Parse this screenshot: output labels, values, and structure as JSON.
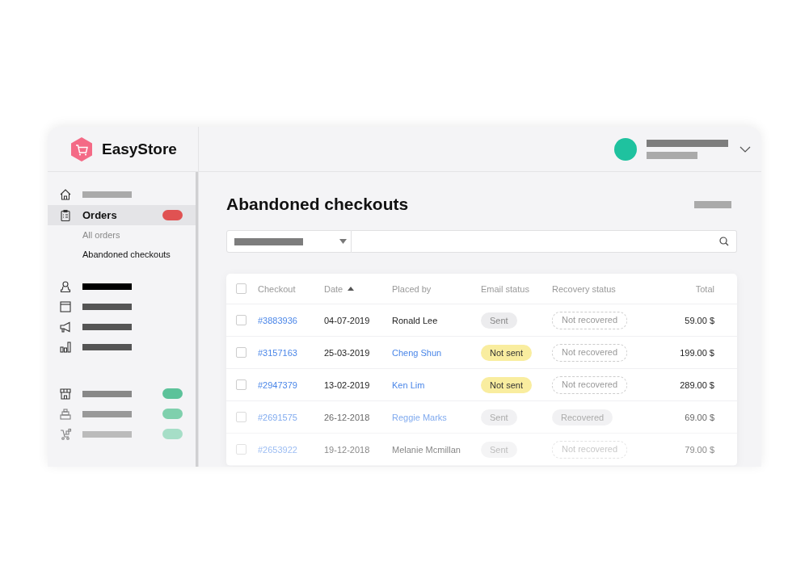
{
  "brand": {
    "name": "EasyStore"
  },
  "sidebar": {
    "groups": [
      [
        {
          "kind": "home",
          "selected": false
        }
      ],
      [
        {
          "kind": "orders",
          "label": "Orders",
          "selected": true,
          "color": "#e05252",
          "children": [
            {
              "label": "All orders",
              "selected": false
            },
            {
              "label": "Abandoned checkouts",
              "selected": true
            }
          ]
        }
      ],
      [
        {
          "kind": "person",
          "selected": false
        },
        {
          "kind": "box",
          "selected": false
        },
        {
          "kind": "megaphone",
          "selected": false
        },
        {
          "kind": "chart",
          "selected": false
        }
      ],
      [
        {
          "kind": "store",
          "selected": false,
          "color": "#5cc29a"
        },
        {
          "kind": "register",
          "selected": false,
          "color": "#7fd0ad"
        },
        {
          "kind": "delivery",
          "selected": false,
          "color": "#a6dec7"
        }
      ]
    ]
  },
  "page": {
    "title": "Abandoned checkouts"
  },
  "table": {
    "all_checked": false,
    "columns": [
      {
        "label": "Checkout",
        "sorted": false
      },
      {
        "label": "Date",
        "sorted": true
      },
      {
        "label": "Placed by",
        "sorted": false
      },
      {
        "label": "Email status",
        "sorted": false
      },
      {
        "label": "Recovery status",
        "sorted": false
      },
      {
        "label": "Total",
        "sorted": false
      }
    ],
    "rows": [
      {
        "checked": false,
        "checkout": "#3883936",
        "date": "04-07-2019",
        "placed_by": "Ronald Lee",
        "linked": false,
        "email": {
          "kind": "sent",
          "label": "Sent"
        },
        "recovery": {
          "kind": "not_recovered",
          "label": "Not recovered"
        },
        "total": "59.00 $"
      },
      {
        "checked": false,
        "checkout": "#3157163",
        "date": "25-03-2019",
        "placed_by": "Cheng Shun",
        "linked": true,
        "email": {
          "kind": "not_sent",
          "label": "Not sent"
        },
        "recovery": {
          "kind": "not_recovered",
          "label": "Not recovered"
        },
        "total": "199.00 $"
      },
      {
        "checked": false,
        "checkout": "#2947379",
        "date": "13-02-2019",
        "placed_by": "Ken Lim",
        "linked": true,
        "email": {
          "kind": "not_sent",
          "label": "Not sent"
        },
        "recovery": {
          "kind": "not_recovered",
          "label": "Not recovered"
        },
        "total": "289.00 $"
      },
      {
        "checked": false,
        "checkout": "#2691575",
        "date": "26-12-2018",
        "placed_by": "Reggie Marks",
        "linked": true,
        "email": {
          "kind": "sent",
          "label": "Sent"
        },
        "recovery": {
          "kind": "recovered",
          "label": "Recovered"
        },
        "total": "69.00 $"
      },
      {
        "checked": false,
        "checkout": "#2653922",
        "date": "19-12-2018",
        "placed_by": "Melanie Mcmillan",
        "linked": false,
        "email": {
          "kind": "sent",
          "label": "Sent"
        },
        "recovery": {
          "kind": "not_recovered",
          "label": "Not recovered"
        },
        "total": "79.00 $"
      }
    ]
  }
}
